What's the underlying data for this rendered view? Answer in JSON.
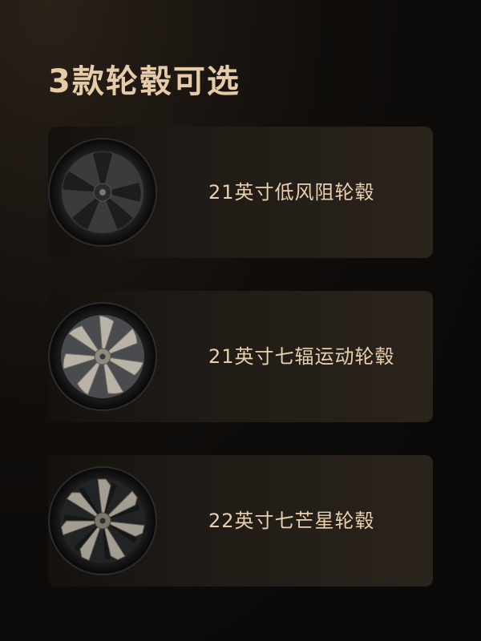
{
  "title": "3款轮毂可选",
  "colors": {
    "accent": "#e6cba7",
    "background": "#0b0a09",
    "card": "#241e18"
  },
  "options": [
    {
      "label": "21英寸低风阻轮毂",
      "icon": "aero-wheel-icon"
    },
    {
      "label": "21英寸七辐运动轮毂",
      "icon": "seven-spoke-wheel-icon"
    },
    {
      "label": "22英寸七芒星轮毂",
      "icon": "seven-star-wheel-icon"
    }
  ]
}
